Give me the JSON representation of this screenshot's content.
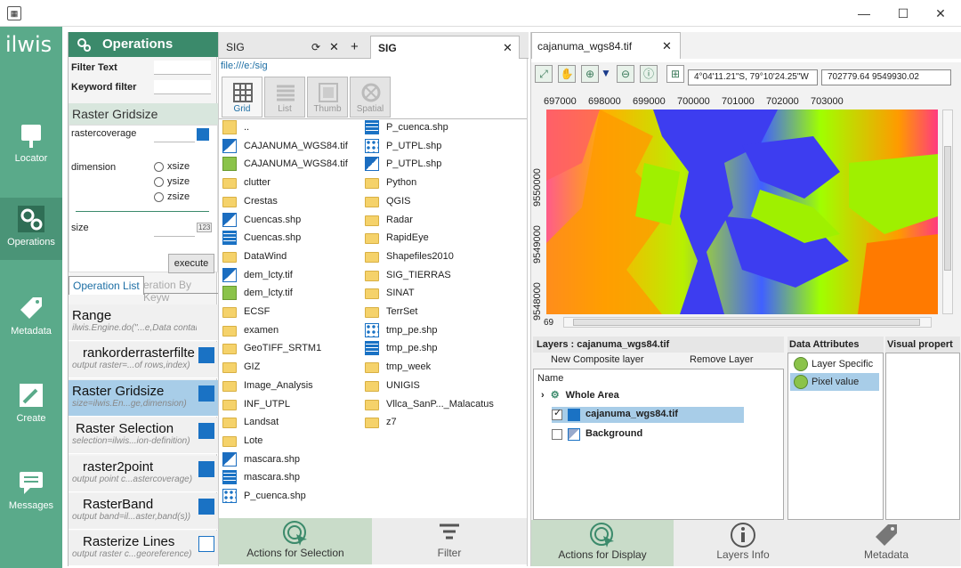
{
  "app": {
    "icon": "ilwis-window-icon",
    "logo": "ilwis",
    "window_controls": [
      "—",
      "☐",
      "✕"
    ]
  },
  "leftbar": {
    "items": [
      {
        "label": "Locator",
        "icon": "locator-icon"
      },
      {
        "label": "Operations",
        "icon": "gears-icon"
      },
      {
        "label": "Metadata",
        "icon": "tag-icon"
      },
      {
        "label": "Create",
        "icon": "create-icon"
      },
      {
        "label": "Messages",
        "icon": "messages-icon"
      }
    ]
  },
  "operations": {
    "title": "Operations",
    "filter_text_label": "Filter Text",
    "keyword_filter_label": "Keyword filter",
    "section_title": "Raster Gridsize",
    "rastercoverage_label": "rastercoverage",
    "dimension_label": "dimension",
    "radios": [
      "xsize",
      "ysize",
      "zsize"
    ],
    "size_label": "size",
    "size_badge": "123",
    "execute_label": "execute",
    "tab_list": "Operation List",
    "tab_keyword": "eration By Keyw",
    "items": [
      {
        "title": "Range",
        "sub": "ilwis.Engine.do(\"...e,Data container)",
        "selected": false
      },
      {
        "title": "rankorderrasterfilte",
        "sub": "output raster=...of rows,index)",
        "selected": false
      },
      {
        "title": "Raster Gridsize",
        "sub": "size=ilwis.En...ge,dimension)",
        "selected": true
      },
      {
        "title": "Raster Selection",
        "sub": "selection=ilwis...ion-definition)",
        "selected": false
      },
      {
        "title": "raster2point",
        "sub": "output point c...astercoverage)",
        "selected": false
      },
      {
        "title": "RasterBand",
        "sub": "output band=il...aster,band(s))",
        "selected": false
      },
      {
        "title": "Rasterize Lines",
        "sub": "output raster c...georeference)",
        "selected": false
      }
    ]
  },
  "browser": {
    "tabs": [
      {
        "label": "SIG",
        "active": false
      },
      {
        "label": "SIG",
        "active": true
      }
    ],
    "tab_controls": [
      "⟳",
      "✕",
      "+"
    ],
    "path": "file:///e:/sig",
    "views": [
      {
        "label": "Grid",
        "active": true
      },
      {
        "label": "List",
        "active": false
      },
      {
        "label": "Thumb",
        "active": false
      },
      {
        "label": "Spatial",
        "active": false
      }
    ],
    "col1": [
      {
        "name": "..",
        "type": "up"
      },
      {
        "name": "CAJANUMA_WGS84.tif",
        "type": "raster"
      },
      {
        "name": "CAJANUMA_WGS84.tif",
        "type": "green"
      },
      {
        "name": "clutter",
        "type": "folder"
      },
      {
        "name": "Crestas",
        "type": "folder"
      },
      {
        "name": "Cuencas.shp",
        "type": "raster"
      },
      {
        "name": "Cuencas.shp",
        "type": "grid"
      },
      {
        "name": "DataWind",
        "type": "folder"
      },
      {
        "name": "dem_lcty.tif",
        "type": "raster"
      },
      {
        "name": "dem_lcty.tif",
        "type": "green"
      },
      {
        "name": "ECSF",
        "type": "folder"
      },
      {
        "name": "examen",
        "type": "folder"
      },
      {
        "name": "GeoTIFF_SRTM1",
        "type": "folder"
      },
      {
        "name": "GIZ",
        "type": "folder"
      },
      {
        "name": "Image_Analysis",
        "type": "folder"
      },
      {
        "name": "INF_UTPL",
        "type": "folder"
      },
      {
        "name": "Landsat",
        "type": "folder"
      },
      {
        "name": "Lote",
        "type": "folder"
      },
      {
        "name": "mascara.shp",
        "type": "raster"
      },
      {
        "name": "mascara.shp",
        "type": "grid"
      },
      {
        "name": "P_cuenca.shp",
        "type": "dots"
      }
    ],
    "col2": [
      {
        "name": "P_cuenca.shp",
        "type": "grid"
      },
      {
        "name": "P_UTPL.shp",
        "type": "dots"
      },
      {
        "name": "P_UTPL.shp",
        "type": "raster"
      },
      {
        "name": "Python",
        "type": "folder"
      },
      {
        "name": "QGIS",
        "type": "folder"
      },
      {
        "name": "Radar",
        "type": "folder"
      },
      {
        "name": "RapidEye",
        "type": "folder"
      },
      {
        "name": "Shapefiles2010",
        "type": "folder"
      },
      {
        "name": "SIG_TIERRAS",
        "type": "folder"
      },
      {
        "name": "SINAT",
        "type": "folder"
      },
      {
        "name": "TerrSet",
        "type": "folder"
      },
      {
        "name": "tmp_pe.shp",
        "type": "dots"
      },
      {
        "name": "tmp_pe.shp",
        "type": "grid"
      },
      {
        "name": "tmp_week",
        "type": "folder"
      },
      {
        "name": "UNIGIS",
        "type": "folder"
      },
      {
        "name": "Vllca_SanP..._Malacatus",
        "type": "folder"
      },
      {
        "name": "z7",
        "type": "folder"
      }
    ],
    "actions_label": "Actions for Selection",
    "filter_label": "Filter"
  },
  "map": {
    "tab": "cajanuma_wgs84.tif",
    "coord_dms": "4°04'11.21\"S, 79°10'24.25\"W",
    "coord_xy": "702779.64 9549930.02",
    "x_ticks": [
      "697000",
      "698000",
      "699000",
      "700000",
      "701000",
      "702000",
      "703000"
    ],
    "y_ticks": [
      "9550000",
      "9549000",
      "9548000"
    ],
    "scroll_value": "69",
    "layers_title": "Layers : cajanuma_wgs84.tif",
    "new_composite": "New Composite layer",
    "remove_layer": "Remove Layer",
    "name_col": "Name",
    "layer_items": [
      {
        "label": "Whole Area",
        "checked": false,
        "selected": false
      },
      {
        "label": "cajanuma_wgs84.tif",
        "checked": true,
        "selected": true
      },
      {
        "label": "Background",
        "checked": false,
        "selected": false
      }
    ],
    "data_attributes_title": "Data Attributes",
    "visual_props_title": "Visual propert",
    "data_attrs": [
      {
        "label": "Layer Specific",
        "selected": false
      },
      {
        "label": "Pixel value",
        "selected": true
      }
    ],
    "bottom_tabs": [
      "Actions for Display",
      "Layers Info",
      "Metadata"
    ],
    "colors": {
      "accent": "#5aaa8a",
      "selected": "#a8cde8",
      "folder": "#f5d26a"
    }
  }
}
